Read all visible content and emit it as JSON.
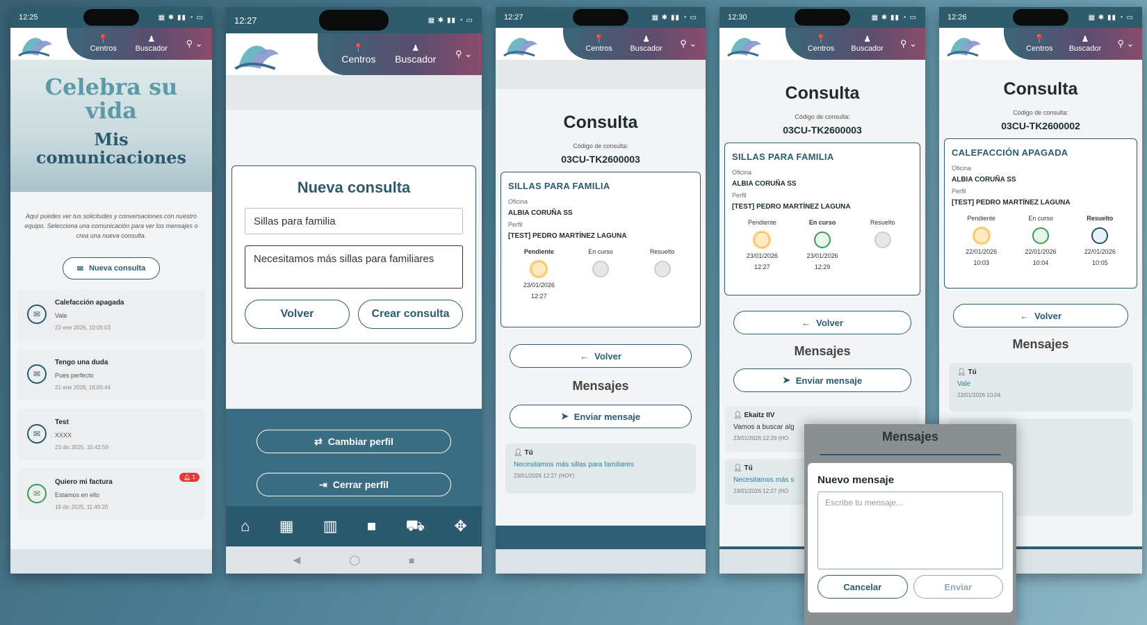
{
  "status_icons": "▦ ✱ ▮▮ ◔ ▭",
  "nav": {
    "centros": "Centros",
    "buscador": "Buscador"
  },
  "icons": {
    "pin": "map-pin-icon",
    "search": "person-search-icon",
    "user": "user-icon",
    "envelope": "envelope-icon"
  },
  "p1": {
    "time": "12:25",
    "hero_title": "Celebra su vida",
    "hero_subtitle": "Mis comunicaciones",
    "intro": "Aquí puedes ver tus solicitudes y conversaciones con nuestro equipo. Selecciona una comunicación para ver los mensajes o crea una nueva consulta.",
    "new_button": "Nueva consulta",
    "items": [
      {
        "title": "Calefacción apagada",
        "snippet": "Vale",
        "date": "22 ene 2026, 10:05:03"
      },
      {
        "title": "Tengo una duda",
        "snippet": "Pues perfecto",
        "date": "21 ene 2026, 16:05:44"
      },
      {
        "title": "Test",
        "snippet": "XXXX",
        "date": "23 dic 2025, 15:42:59"
      },
      {
        "title": "Quiero mi factura",
        "snippet": "Estamos en ello",
        "date": "19 dic 2025, 11:49:20",
        "badge": "1"
      }
    ]
  },
  "p2": {
    "time": "12:27",
    "form_title": "Nueva consulta",
    "subject_value": "Sillas para familia",
    "body_value": "Necesitamos más sillas para familiares",
    "back": "Volver",
    "create": "Crear consulta",
    "change_profile": "Cambiar perfil",
    "close_profile": "Cerrar perfil"
  },
  "p3": {
    "time": "12:27",
    "title": "Consulta",
    "code_label": "Código de consulta:",
    "code": "03CU-TK2600003",
    "subject": "SILLAS PARA FAMILIA",
    "office_label": "Oficina",
    "office": "ALBIA CORUÑA SS",
    "profile_label": "Perfil",
    "profile": "[TEST] PEDRO MARTÍNEZ LAGUNA",
    "steps": [
      {
        "name": "Pendiente",
        "date": "23/01/2026",
        "time": "12:27"
      },
      {
        "name": "En curso",
        "date": "",
        "time": ""
      },
      {
        "name": "Resuelto",
        "date": "",
        "time": ""
      }
    ],
    "back": "Volver",
    "messages_title": "Mensajes",
    "send": "Enviar mensaje",
    "messages": [
      {
        "who": "Tú",
        "text": "Necesitamos más sillas para familiares",
        "ts": "23/01/2026 12:27 (HOY)"
      }
    ]
  },
  "p4": {
    "time": "12:30",
    "title": "Consulta",
    "code_label": "Código de consulta:",
    "code": "03CU-TK2600003",
    "subject": "SILLAS PARA FAMILIA",
    "office_label": "Oficina",
    "office": "ALBIA CORUÑA SS",
    "profile_label": "Perfil",
    "profile": "[TEST] PEDRO MARTÍNEZ LAGUNA",
    "steps": [
      {
        "name": "Pendiente",
        "date": "23/01/2026",
        "time": "12:27"
      },
      {
        "name": "En curso",
        "date": "23/01/2026",
        "time": "12:29"
      },
      {
        "name": "Resuelto",
        "date": "",
        "time": ""
      }
    ],
    "back": "Volver",
    "messages_title": "Mensajes",
    "send": "Enviar mensaje",
    "messages": [
      {
        "who": "Ekaitz IIV",
        "text": "Vamos a buscar alg",
        "ts": "23/01/2026 12:29 (HO"
      },
      {
        "who": "Tú",
        "text": "Necesitamos más s",
        "ts": "23/01/2026 12:27 (HO"
      }
    ]
  },
  "p5": {
    "time": "12:26",
    "title": "Consulta",
    "code_label": "Código de consulta:",
    "code": "03CU-TK2600002",
    "subject": "CALEFACCIÓN APAGADA",
    "office_label": "Oficina",
    "office": "ALBIA CORUÑA SS",
    "profile_label": "Perfil",
    "profile": "[TEST] PEDRO MARTÍNEZ LAGUNA",
    "steps": [
      {
        "name": "Pendiente",
        "date": "22/01/2026",
        "time": "10:03"
      },
      {
        "name": "En curso",
        "date": "22/01/2026",
        "time": "10:04"
      },
      {
        "name": "Resuelto",
        "date": "22/01/2026",
        "time": "10:05"
      }
    ],
    "back": "Volver",
    "messages_title": "Mensajes",
    "messages": [
      {
        "who": "Tú",
        "text": "Vale",
        "ts": "22/01/2026 10:04"
      }
    ]
  },
  "modal": {
    "bg_title": "Mensajes",
    "title": "Nuevo mensaje",
    "placeholder": "Escribe tu mensaje...",
    "cancel": "Cancelar",
    "send": "Enviar"
  },
  "colors": {
    "primary": "#2b5a6e",
    "accent": "#8a4c6c",
    "pending": "#f2c35e",
    "inprogress": "#3c9a52",
    "badge": "#e53935"
  }
}
